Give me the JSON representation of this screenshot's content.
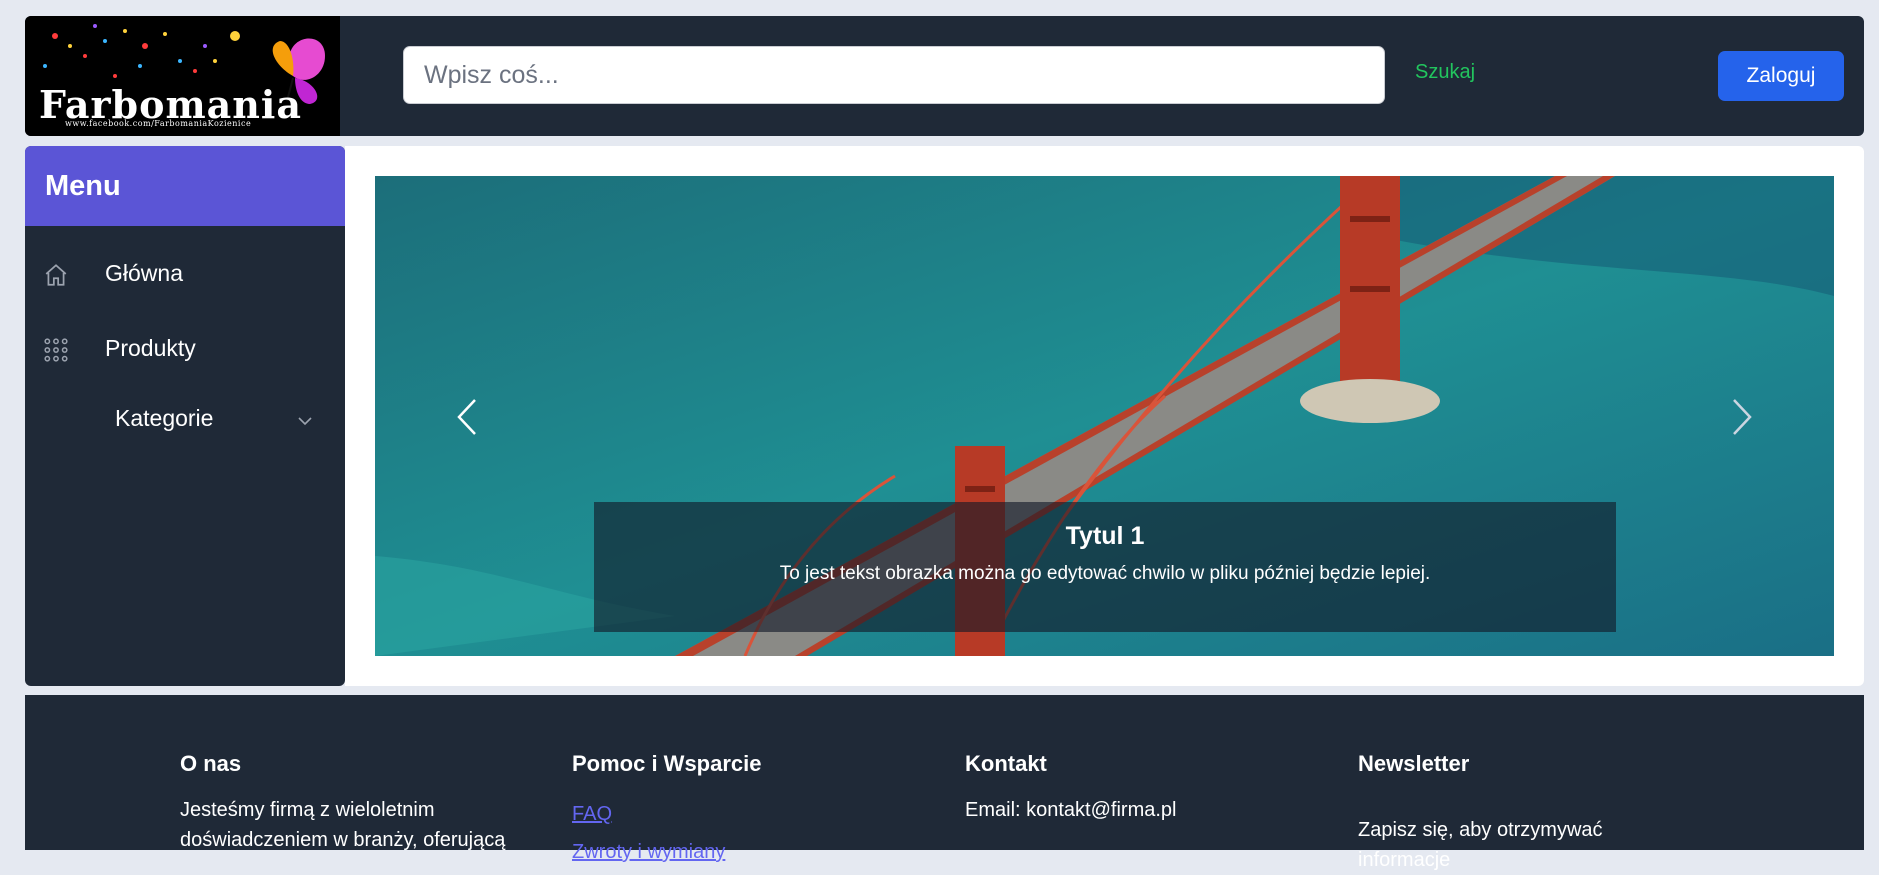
{
  "header": {
    "logo": {
      "brand": "Farbomania",
      "sub": "www.facebook.com/FarbomaniaKozienice"
    },
    "search_placeholder": "Wpisz coś...",
    "search_label": "Szukaj",
    "login_label": "Zaloguj"
  },
  "sidebar": {
    "title": "Menu",
    "items": [
      {
        "label": "Główna",
        "icon": "home-icon"
      },
      {
        "label": "Produkty",
        "icon": "grid-icon"
      }
    ],
    "sub_item": {
      "label": "Kategorie",
      "icon": "chevron-down-icon"
    }
  },
  "carousel": {
    "slide_title": "Tytul 1",
    "slide_text": "To jest tekst obrazka można go edytować chwilo w pliku później będzie lepiej."
  },
  "footer": {
    "about": {
      "heading": "O nas",
      "line1": "Jesteśmy firmą z wieloletnim",
      "line2": "doświadczeniem w branży, oferującą"
    },
    "help": {
      "heading": "Pomoc i Wsparcie",
      "links": [
        "FAQ",
        "Zwroty i wymiany"
      ]
    },
    "contact": {
      "heading": "Kontakt",
      "email": "Email: kontakt@firma.pl"
    },
    "newsletter": {
      "heading": "Newsletter",
      "text": "Zapisz się, aby otrzymywać informacje"
    }
  },
  "colors": {
    "dark": "#1f2937",
    "accent": "#5b55d6",
    "primary_button": "#2563eb",
    "search_link": "#22c55e",
    "link": "#6366f1"
  }
}
